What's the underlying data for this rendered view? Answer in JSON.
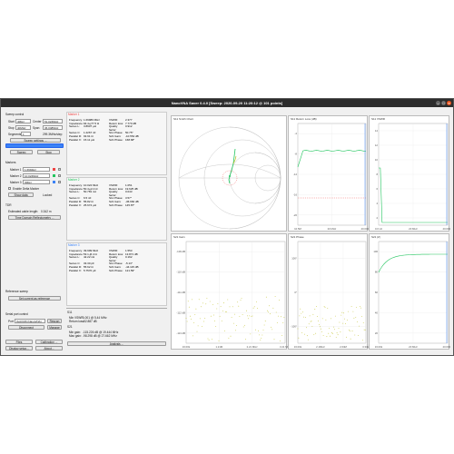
{
  "window": {
    "title": "NanoVNA Saver 0.4.0 [Sweep: 2020-09-20 11:20:12 @ 101 points]"
  },
  "sweep": {
    "header": "Sweep control",
    "start_label": "Start",
    "start_value": "4MHz",
    "center_label": "Center",
    "center_value": "51.024MHz",
    "stop_label": "Stop",
    "stop_value": "40MHz",
    "span_label": "Span",
    "span_value": "36.048MHz",
    "segments_label": "Segments",
    "segments_value": "1",
    "step_value": "299.3MHz/step",
    "settings_button": "Sweep settings ...",
    "sweep_button": "Sweep",
    "stop_button": "Stop"
  },
  "markers": {
    "header": "Markers",
    "items": [
      {
        "label": "Marker 1",
        "value": "1.6994Hz",
        "color": "#ef4444"
      },
      {
        "label": "Marker 2",
        "value": "10.024MHz",
        "color": "#22c55e"
      },
      {
        "label": "Marker 3",
        "value": "3MHz",
        "color": "#3b82f6"
      }
    ],
    "delta_label": "Enable Delta Marker",
    "show_data": "Show data",
    "locked": "Locked"
  },
  "tdr": {
    "header": "TDR",
    "length_label": "Estimated cable length:",
    "length_value": "0.342 m",
    "window_button": "Time Domain Reflectometry ..."
  },
  "reference": {
    "header": "Reference sweep",
    "set_button": "Set current as reference"
  },
  "serial": {
    "header": "Serial port control",
    "port_label": "Port",
    "port_value": "ttyACM0 (NanoVNA)",
    "rescan": "Rescan",
    "disconnect": "Disconnect",
    "manage": "Manage"
  },
  "bottom": {
    "files": "Files",
    "calibration": "Calibration ...",
    "display": "Display setup...",
    "about": "About..."
  },
  "marker_panels": [
    {
      "title": "Marker 1",
      "color": "#ef4444",
      "rows": [
        [
          "Frequency:",
          "1.69989 MHz",
          "VSWR:",
          "2.377"
        ],
        [
          "Impedance:",
          "94.4+j77.5 Ω",
          "Return loss:",
          "7.770 dB"
        ],
        [
          "Series L:",
          "3.8907 µH",
          "Quality factor:",
          "0.912"
        ],
        [
          "Series C:",
          "1.2267 nF",
          "S11 Phase:",
          "50.75°"
        ],
        [
          "Parallel R:",
          "93.91 Ω",
          "S21 Gain:",
          "-10.554 dB"
        ],
        [
          "Parallel X:",
          "15.11 µH",
          "S21 Phase:",
          "168.68°"
        ]
      ]
    },
    {
      "title": "Marker 2",
      "color": "#22c55e",
      "rows": [
        [
          "Frequency:",
          "10.024 MHz",
          "VSWR:",
          "1.051"
        ],
        [
          "Impedance:",
          "50.4+j2.4 Ω",
          "Return loss:",
          "19.625 dB"
        ],
        [
          "Series L:",
          "50.781 nH",
          "Quality factor:",
          "0.043"
        ],
        [
          "Series C:",
          "6.5 nF",
          "S11 Phase:",
          "3.57°"
        ],
        [
          "Parallel R:",
          "55.82 Ω",
          "S21 Gain:",
          "-36.660 dB"
        ],
        [
          "Parallel X:",
          "25.674 µH",
          "S21 Phase:",
          "145.87°"
        ]
      ]
    },
    {
      "title": "Marker 3",
      "color": "#3b82f6",
      "rows": [
        [
          "Frequency:",
          "39.999 MHz",
          "VSWR:",
          "1.553"
        ],
        [
          "Impedance:",
          "53.1-j6.4 Ω",
          "Return loss:",
          "13.871 dB"
        ],
        [
          "Series L:",
          "42.22 nH",
          "Quality factor:",
          "0.162"
        ],
        [
          "Series C:",
          "33.30 pF",
          "S11 Phase:",
          "-5.13°"
        ],
        [
          "Parallel R:",
          "55.62 Ω",
          "S21 Gain:",
          "-44.115 dB"
        ],
        [
          "Parallel X:",
          "5.7570 µF",
          "S21 Phase:",
          "121.59°"
        ]
      ]
    }
  ],
  "s11_summary": {
    "header": "S11",
    "vswr_label": "Min VSWR:",
    "vswr_value": "1.001 @ 5.44 MHz",
    "rl_label": "Return loss:",
    "rl_value": "-52.887 dB",
    "s21_header": "S21",
    "gain_label": "Min gain:",
    "gain_value": "-115.226 dB @ 19.444 MHz",
    "max_label": "Max gain:",
    "max_value": "-98.298 dB @ 27.662 MHz"
  },
  "analysis_button": "Analysis ...",
  "charts": {
    "smith": {
      "title": "S11 Smith Chart"
    },
    "return_loss": {
      "title": "S11 Return Loss (dB)",
      "y_ticks": [
        "-4",
        "-8",
        "-12",
        "-16",
        "-20"
      ],
      "x_ticks": [
        "10.5M",
        "20 MHz",
        "40.000M"
      ]
    },
    "vswr": {
      "title": "S11 VSWR",
      "y_ticks": [
        "14",
        "12",
        "10",
        "8",
        "6",
        "4",
        "2"
      ],
      "x_ticks": [
        "0.0 Hz",
        "20 MHz",
        "40.000M"
      ]
    },
    "s21_gain": {
      "title": "S21 Gain",
      "y_ticks": [
        "-109 dB",
        "-110 dB",
        "-111 dB",
        "-112 dB",
        "-113 dB"
      ],
      "x_ticks": [
        "16.00k",
        "1.21M",
        "2.21 MHz",
        "3.21 MHz"
      ]
    },
    "s21_phase": {
      "title": "S21 Phase",
      "y_ticks": [
        "100°",
        "0°",
        "-100°"
      ],
      "x_ticks": [
        "16.00k",
        "2.1MHz",
        "2.64M",
        "3.34M"
      ]
    },
    "s21_vswr": {
      "title": "S21 |Z|",
      "y_ticks": [
        "100",
        "80",
        "60",
        "40",
        "20"
      ],
      "x_ticks": [
        "16.00k",
        "20 MHz",
        "40.000M"
      ]
    }
  }
}
